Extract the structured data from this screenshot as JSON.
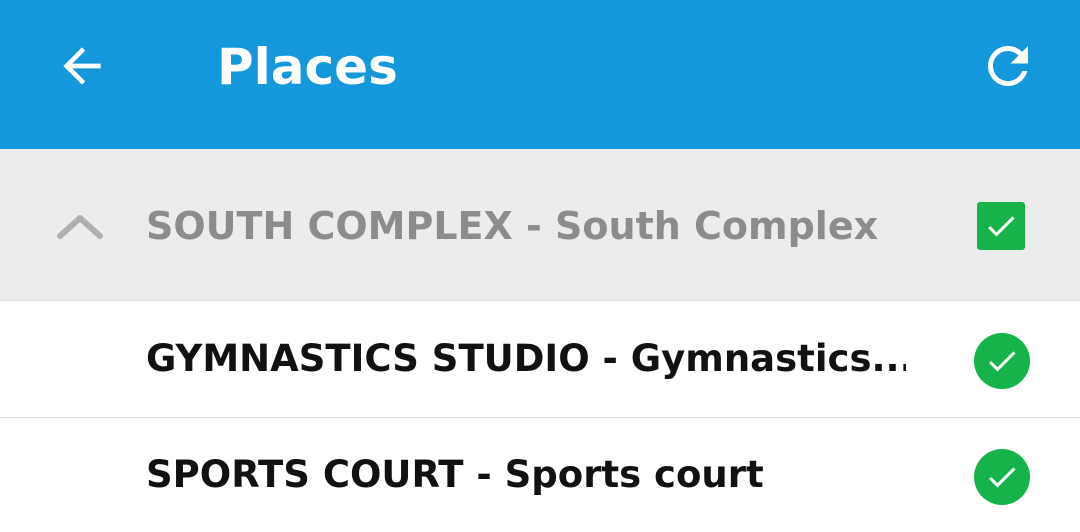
{
  "header": {
    "title": "Places",
    "back_icon": "arrow-left-icon",
    "refresh_icon": "refresh-icon",
    "background_color": "#1497db"
  },
  "group": {
    "label": "SOUTH COMPLEX - South Complex",
    "expanded": true,
    "checked": true,
    "collapse_icon": "chevron-up-icon",
    "check_icon": "checkbox-checked-icon"
  },
  "items": [
    {
      "label": "GYMNASTICS STUDIO - Gymnastics...",
      "checked": true,
      "check_icon": "check-circle-icon"
    },
    {
      "label": "SPORTS COURT - Sports court",
      "checked": true,
      "check_icon": "check-circle-icon"
    }
  ],
  "colors": {
    "accent": "#1497db",
    "success": "#15b34a",
    "group_background": "#ececec",
    "group_text": "#8c8c8c"
  }
}
